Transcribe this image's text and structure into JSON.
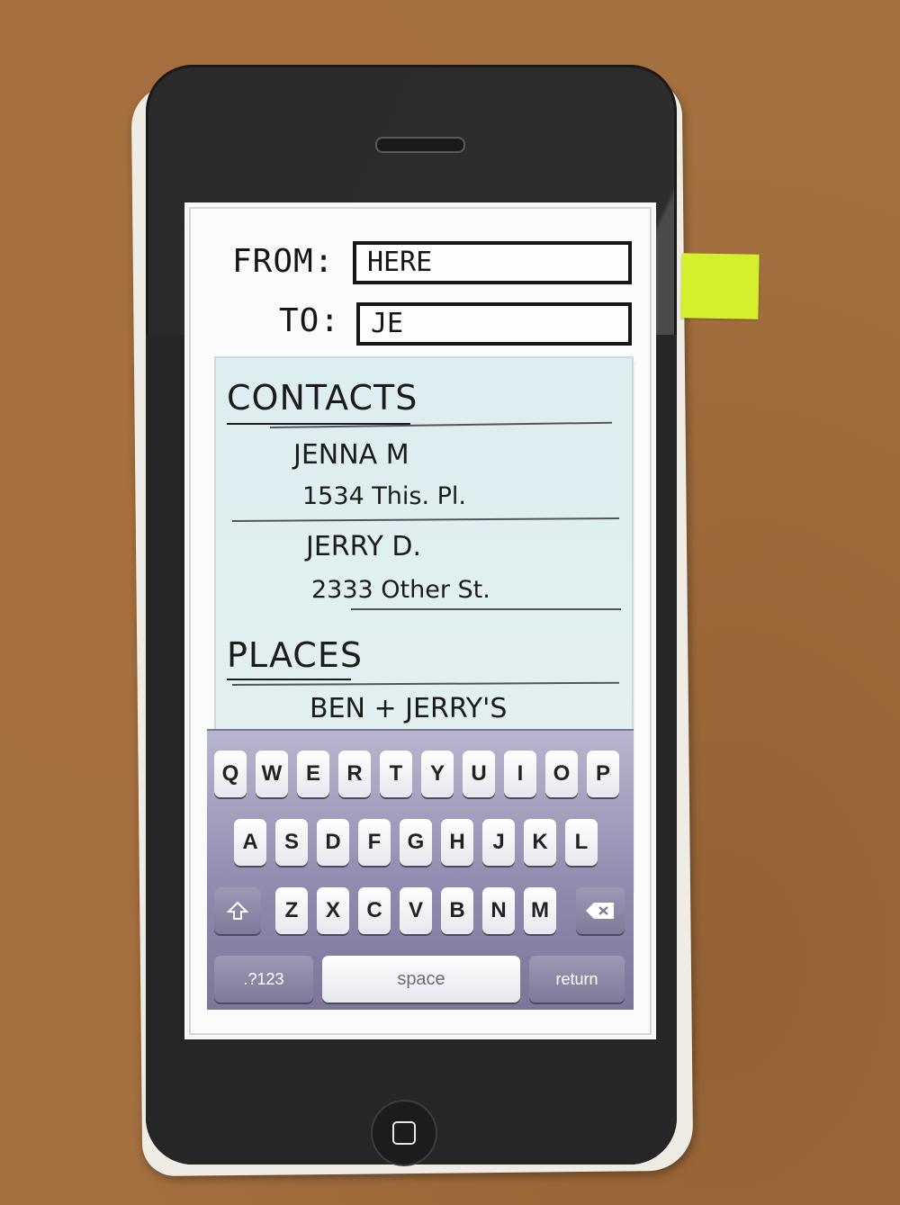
{
  "header": {
    "from_label": "FROM:",
    "from_value": "HERE",
    "to_label": "TO:",
    "to_value": "JE"
  },
  "results": {
    "contacts_heading": "CONTACTS",
    "contacts": [
      {
        "name": "JENNA M",
        "address": "1534 This. Pl."
      },
      {
        "name": "JERRY D.",
        "address": "2333 Other St."
      }
    ],
    "places_heading": "PLACES",
    "places": [
      {
        "name": "BEN + JERRY'S"
      }
    ]
  },
  "keyboard": {
    "row1": [
      "Q",
      "W",
      "E",
      "R",
      "T",
      "Y",
      "U",
      "I",
      "O",
      "P"
    ],
    "row2": [
      "A",
      "S",
      "D",
      "F",
      "G",
      "H",
      "J",
      "K",
      "L"
    ],
    "row3": [
      "Z",
      "X",
      "C",
      "V",
      "B",
      "N",
      "M"
    ],
    "shift_icon": "shift-arrow-icon",
    "delete_icon": "backspace-icon",
    "numbers_label": ".?123",
    "space_label": "space",
    "return_label": "return"
  },
  "colors": {
    "results_bg": "#ddeef0",
    "keyboard_bg": "#8e88ad",
    "sticky_note": "#d6ef2c"
  }
}
